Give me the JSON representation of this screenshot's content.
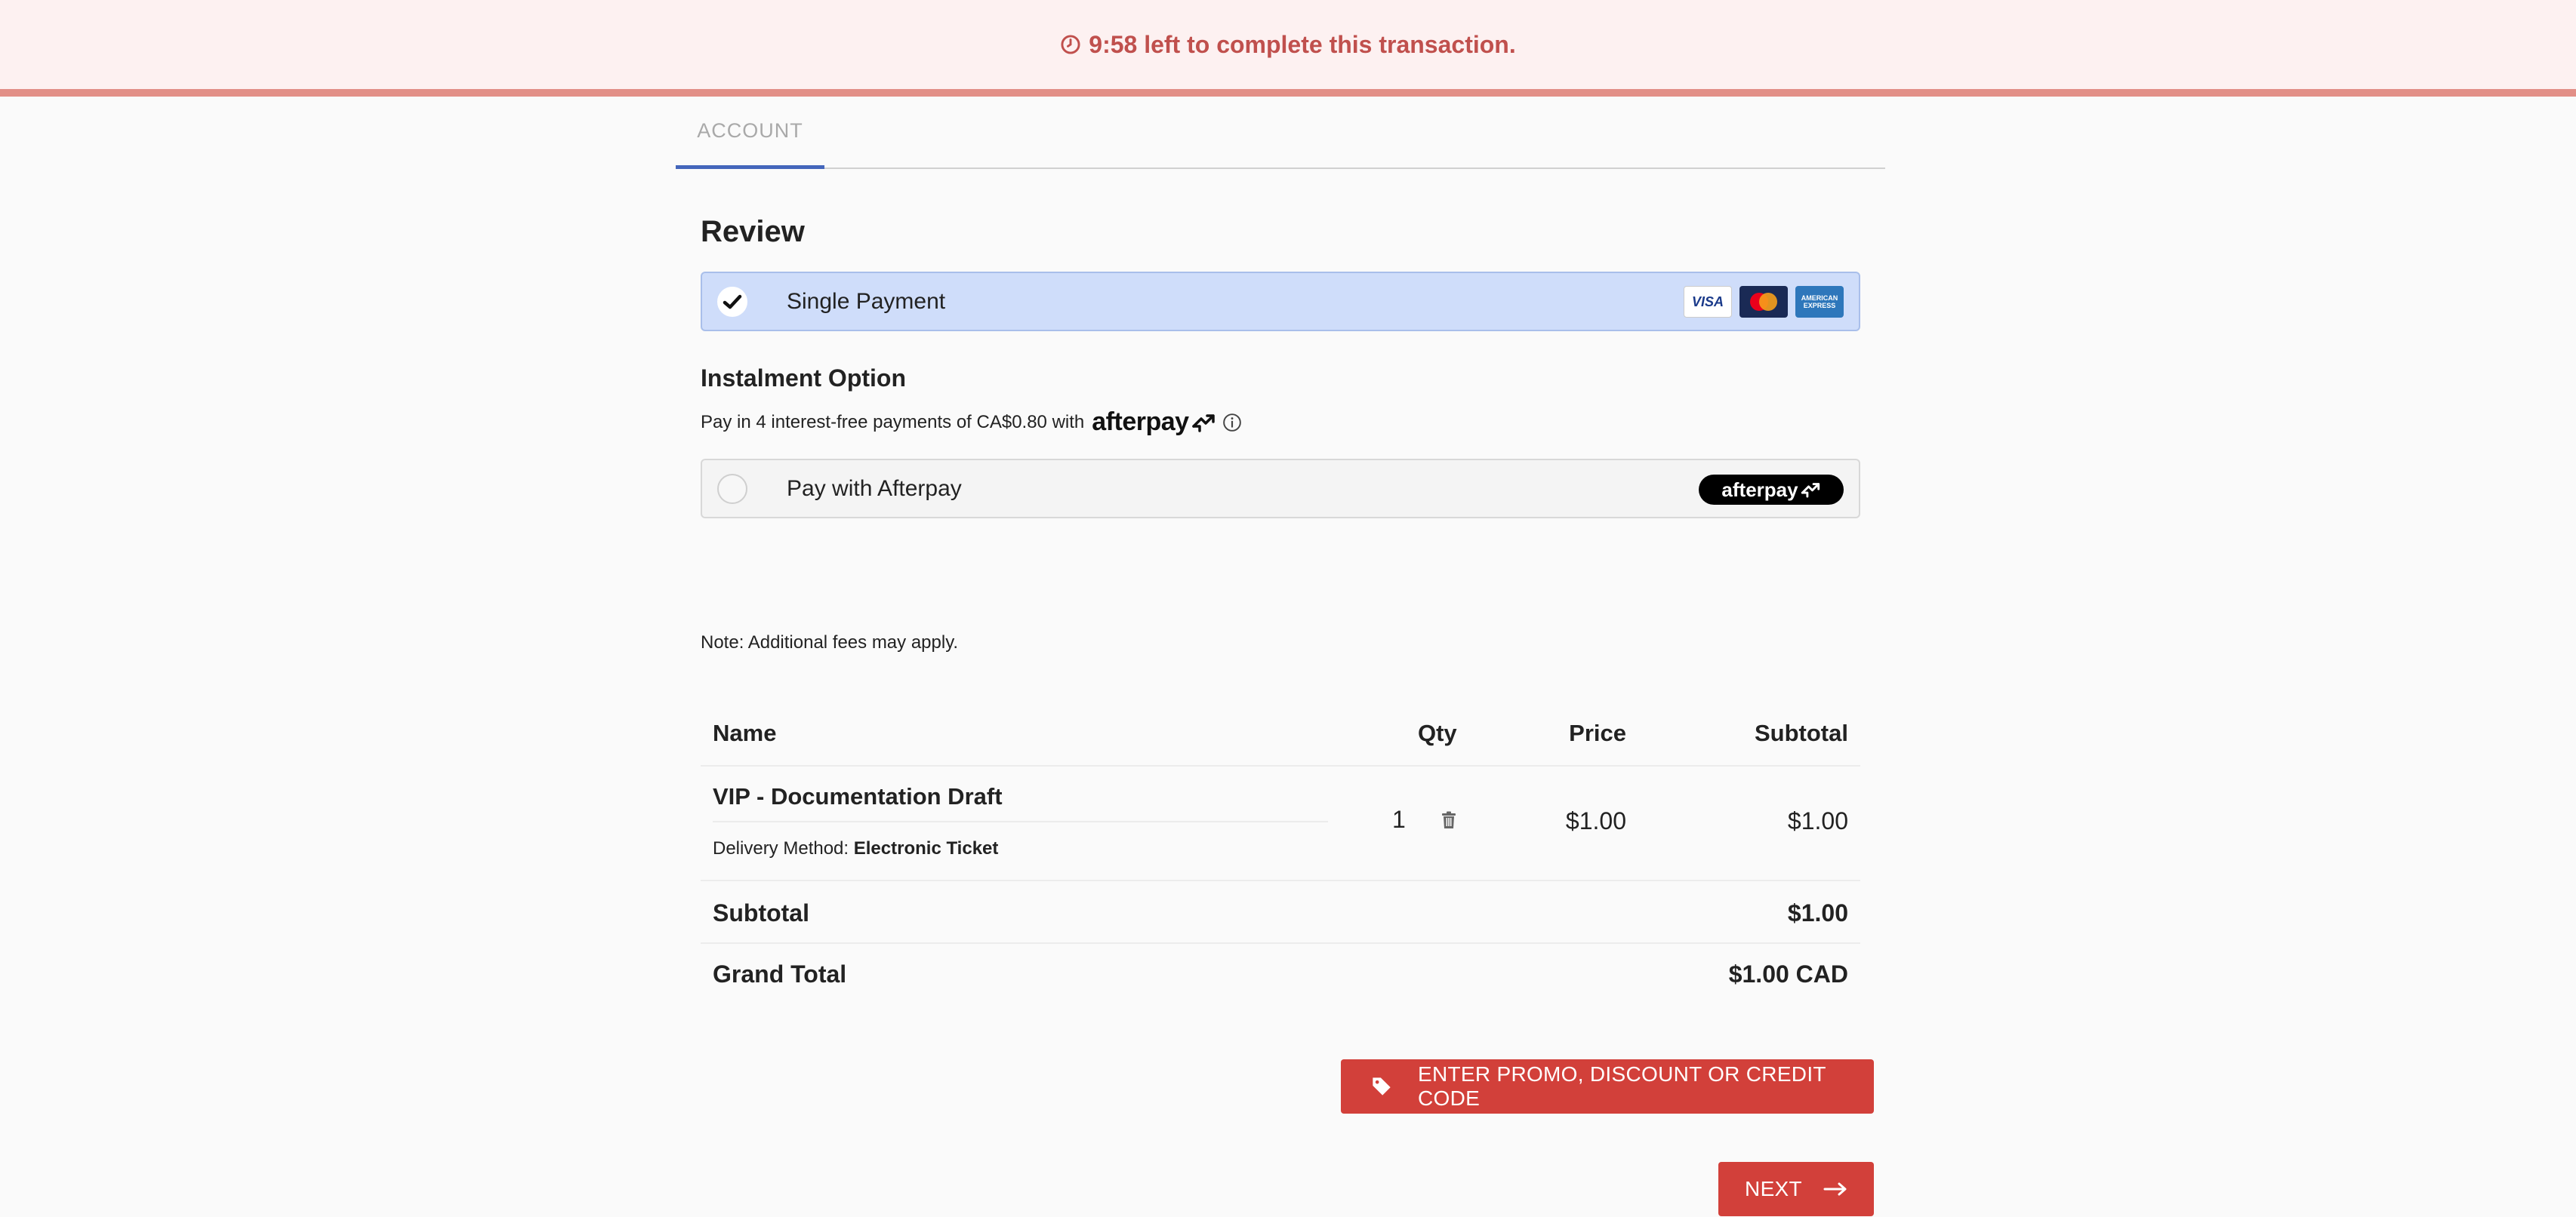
{
  "timer": {
    "text": "9:58 left to complete this transaction."
  },
  "tabs": [
    {
      "label": "ACCOUNT"
    }
  ],
  "review": {
    "title": "Review",
    "single_payment": {
      "label": "Single Payment",
      "selected": true,
      "cards": [
        "VISA",
        "Mastercard",
        "AMERICAN EXPRESS"
      ]
    },
    "instalment": {
      "title": "Instalment Option",
      "pay_in_text": "Pay in 4 interest-free payments of CA$0.80 with",
      "afterpay_wordmark": "afterpay",
      "afterpay_option_label": "Pay with Afterpay",
      "afterpay_badge": "afterpay",
      "selected": false
    },
    "note": "Note: Additional fees may apply."
  },
  "order_table": {
    "headers": {
      "name": "Name",
      "qty": "Qty",
      "price": "Price",
      "subtotal": "Subtotal"
    },
    "items": [
      {
        "name": "VIP - Documentation Draft",
        "delivery_label": "Delivery Method:",
        "delivery_value": "Electronic Ticket",
        "qty": "1",
        "price": "$1.00",
        "subtotal": "$1.00"
      }
    ],
    "subtotal": {
      "label": "Subtotal",
      "value": "$1.00"
    },
    "grand_total": {
      "label": "Grand Total",
      "value": "$1.00 CAD"
    }
  },
  "buttons": {
    "promo_label": "ENTER PROMO, DISCOUNT OR CREDIT CODE",
    "next_label": "NEXT"
  },
  "colors": {
    "banner_bg": "#fdf1f1",
    "banner_text": "#c0504d",
    "accent_blue": "#4466bb",
    "selected_bg": "#cfddfa",
    "button_red": "#d2403a"
  },
  "icons": {
    "timer": "clock-icon",
    "selected": "checkmark-icon",
    "info": "info-icon",
    "delete": "trash-icon",
    "promo": "tag-icon",
    "next": "arrow-right-icon"
  }
}
